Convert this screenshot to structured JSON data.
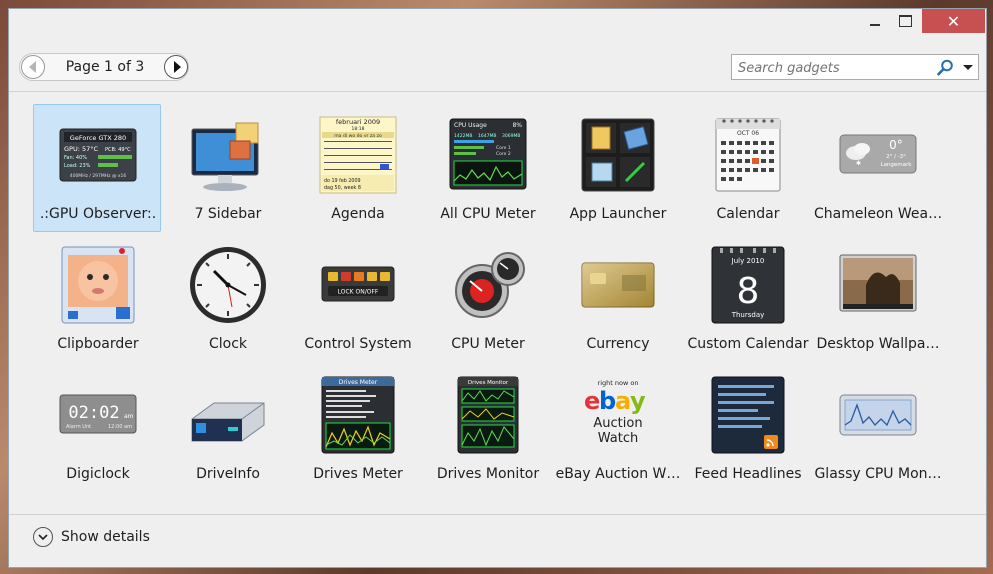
{
  "window": {
    "close_label": "✕"
  },
  "pager": {
    "page_text": "Page 1 of 3"
  },
  "search": {
    "placeholder": "Search gadgets",
    "value": ""
  },
  "gadgets": [
    {
      "label": ".:GPU Observer:.",
      "icon": "gpu-observer-icon",
      "selected": true,
      "icon_text": {
        "title": "GeForce GTX 280",
        "gpu": "GPU: 57°C",
        "pcb": "PCB: 49°C",
        "fan": "Fan: 40%",
        "load": "Load: 23%",
        "clock": "400MHz / 297MHz @ x16"
      }
    },
    {
      "label": "7 Sidebar",
      "icon": "monitor-icon"
    },
    {
      "label": "Agenda",
      "icon": "agenda-calendar-icon",
      "icon_text": {
        "month": "februari 2009",
        "time": "18:18",
        "days": "ma di wo do vr za zo",
        "footer1": "do 19 feb 2009",
        "footer2": "dag 50, week 8"
      }
    },
    {
      "label": "All CPU Meter",
      "icon": "cpu-usage-icon",
      "icon_text": {
        "title": "CPU Usage",
        "percent": "8%",
        "used": "1422MB",
        "free": "1647MB",
        "total": "3069MB",
        "core1": "Core 1",
        "core2": "Core 2"
      }
    },
    {
      "label": "App Launcher",
      "icon": "app-launcher-icon"
    },
    {
      "label": "Calendar",
      "icon": "calendar-icon",
      "icon_text": {
        "month": "OCT 06"
      }
    },
    {
      "label": "Chameleon Wea…",
      "icon": "weather-icon",
      "icon_text": {
        "temp": "0°",
        "range": "2° / -3°",
        "place": "Langemark"
      }
    },
    {
      "label": "Clipboarder",
      "icon": "clipboarder-icon"
    },
    {
      "label": "Clock",
      "icon": "clock-icon"
    },
    {
      "label": "Control System",
      "icon": "control-system-icon",
      "icon_text": {
        "lock": "LOCK ON/OFF"
      }
    },
    {
      "label": "CPU Meter",
      "icon": "cpu-meter-icon"
    },
    {
      "label": "Currency",
      "icon": "currency-card-icon"
    },
    {
      "label": "Custom Calendar",
      "icon": "custom-calendar-icon",
      "icon_text": {
        "month": "July 2010",
        "day": "8",
        "weekday": "Thursday"
      }
    },
    {
      "label": "Desktop Wallpa…",
      "icon": "wallpaper-icon"
    },
    {
      "label": "Digiclock",
      "icon": "digiclock-icon",
      "icon_text": {
        "time": "02:02",
        "ampm": "am",
        "alarm": "Alarm Unt",
        "alarm_time": "12:00 am"
      }
    },
    {
      "label": "DriveInfo",
      "icon": "drive-icon"
    },
    {
      "label": "Drives Meter",
      "icon": "drives-meter-icon",
      "icon_text": {
        "title": "Drives Meter"
      }
    },
    {
      "label": "Drives Monitor",
      "icon": "drives-monitor-icon",
      "icon_text": {
        "title": "Drives Monitor"
      }
    },
    {
      "label": "eBay Auction W…",
      "icon": "ebay-icon",
      "icon_text": {
        "top": "right now on",
        "line1": "Auction",
        "line2": "Watch"
      }
    },
    {
      "label": "Feed Headlines",
      "icon": "feed-headlines-icon"
    },
    {
      "label": "Glassy CPU Mon…",
      "icon": "glassy-cpu-icon"
    }
  ],
  "footer": {
    "details_label": "Show details"
  },
  "colors": {
    "selection": "#cce4f7",
    "close_button": "#c75050"
  }
}
